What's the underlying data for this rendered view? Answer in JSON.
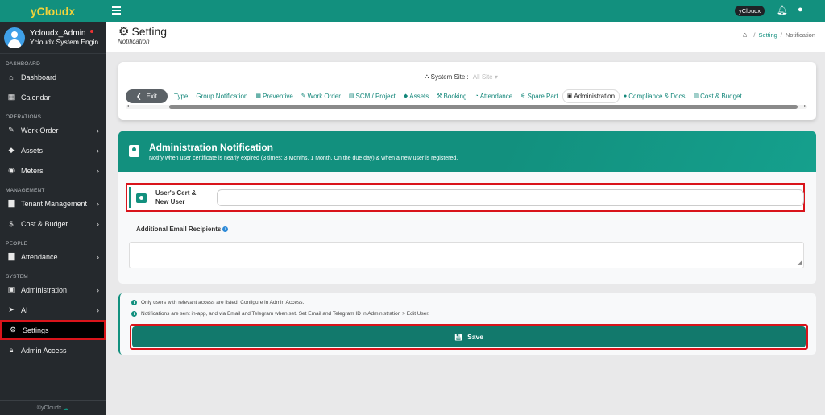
{
  "brand": "yCloudx",
  "user": {
    "name": "Ycloudx_Admin",
    "role": "Ycloudx System Engin..."
  },
  "sidebar": {
    "sections": [
      {
        "title": "DASHBOARD",
        "items": [
          {
            "label": "Dashboard",
            "icon": "home-icon",
            "chevron": false
          },
          {
            "label": "Calendar",
            "icon": "calendar-icon",
            "chevron": false
          }
        ]
      },
      {
        "title": "OPERATIONS",
        "items": [
          {
            "label": "Work Order",
            "icon": "wrench-icon",
            "chevron": true
          },
          {
            "label": "Assets",
            "icon": "tag-icon",
            "chevron": true
          },
          {
            "label": "Meters",
            "icon": "gauge-icon",
            "chevron": true
          }
        ]
      },
      {
        "title": "MANAGEMENT",
        "items": [
          {
            "label": "Tenant Management",
            "icon": "building-icon",
            "chevron": true
          },
          {
            "label": "Cost & Budget",
            "icon": "dollar-icon",
            "chevron": true
          }
        ]
      },
      {
        "title": "PEOPLE",
        "items": [
          {
            "label": "Attendance",
            "icon": "building-icon",
            "chevron": true
          }
        ]
      },
      {
        "title": "SYSTEM",
        "items": [
          {
            "label": "Administration",
            "icon": "id-card-icon",
            "chevron": true
          },
          {
            "label": "AI",
            "icon": "rocket-icon",
            "chevron": true
          },
          {
            "label": "Settings",
            "icon": "gear-icon",
            "chevron": false,
            "active": true
          },
          {
            "label": "Admin Access",
            "icon": "lock-icon",
            "chevron": false
          }
        ]
      }
    ],
    "footer": "©yCloudx"
  },
  "topbar": {
    "tenant_pill": "yCloudx"
  },
  "header": {
    "title": "Setting",
    "subtitle": "Notification",
    "breadcrumb": {
      "link": "Setting",
      "current": "Notification"
    }
  },
  "site_selector": {
    "label": "System Site :",
    "value": "All Site"
  },
  "tabs": {
    "exit_label": "Exit",
    "items": [
      {
        "label": "Type",
        "icon": ""
      },
      {
        "label": "Group Notification",
        "icon": ""
      },
      {
        "label": "Preventive",
        "icon": "calendar-icon"
      },
      {
        "label": "Work Order",
        "icon": "wrench-icon"
      },
      {
        "label": "SCM / Project",
        "icon": "document-icon"
      },
      {
        "label": "Assets",
        "icon": "tag-icon"
      },
      {
        "label": "Booking",
        "icon": "gavel-icon"
      },
      {
        "label": "Attendance",
        "icon": "clock-icon"
      },
      {
        "label": "Spare Part",
        "icon": "sliders-icon"
      },
      {
        "label": "Administration",
        "icon": "id-card-icon",
        "active": true
      },
      {
        "label": "Compliance & Docs",
        "icon": "circle-icon"
      },
      {
        "label": "Cost & Budget",
        "icon": "bar-chart-icon"
      }
    ]
  },
  "notification": {
    "title": "Administration Notification",
    "description": "Notify when user certificate is nearly expired (3 times: 3 Months, 1 Month, On the due day) & when a new user is registered.",
    "cert_label": "User's Cert & New User",
    "cert_value": "",
    "email_label": "Additional Email Recipients",
    "email_value": ""
  },
  "notes": [
    "Only users with relevant access are listed. Configure in Admin Access.",
    "Notifications are sent in-app, and via Email and Telegram when set. Set Email and Telegram ID in Administration > Edit User."
  ],
  "save_label": "Save",
  "colors": {
    "primary": "#12907e",
    "highlight": "#d9141b",
    "brand_text": "#f2d33a"
  }
}
